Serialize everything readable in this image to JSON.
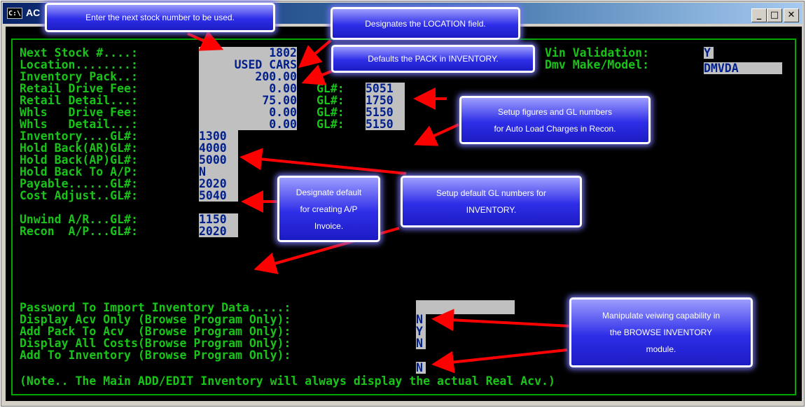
{
  "window": {
    "title": "AC",
    "icon_text": "C:\\",
    "minimize_label": "_",
    "maximize_label": "□",
    "close_label": "✕"
  },
  "colors": {
    "terminal_bg": "#000000",
    "terminal_text": "#19c419",
    "field_bg": "#c0c0c0",
    "field_text": "#001f8a",
    "callout_bg": "#2e2ee8",
    "arrow": "#ff0000"
  },
  "form": {
    "labels": {
      "next_stock": "Next Stock #....:",
      "location": "Location........:",
      "inventory_pack": "Inventory Pack..:",
      "retail_drive_fee": "Retail Drive Fee:",
      "retail_detail": "Retail Detail...:",
      "whls_drive_fee": "Whls   Drive Fee:",
      "whls_detail": "Whls   Detail...:",
      "inventory_gl": "Inventory....GL#:",
      "hold_back_ar_gl": "Hold Back(AR)GL#:",
      "hold_back_ap_gl": "Hold Back(AP)GL#:",
      "hold_back_to_ap": "Hold Back To A/P:",
      "payable_gl": "Payable......GL#:",
      "cost_adjust_gl": "Cost Adjust..GL#:",
      "unwind_ar_gl": "Unwind A/R...GL#:",
      "recon_ap_gl": "Recon  A/P...GL#:",
      "vin_validation": "Vin Validation:",
      "dmv_make_model": "Dmv Make/Model:",
      "gl_prefix": "GL#:",
      "password_import": "Password To Import Inventory Data.....:",
      "display_acv_only": "Display Acv Only (Browse Program Only):",
      "add_pack_to_acv": "Add Pack To Acv  (Browse Program Only):",
      "display_all_costs": "Display All Costs(Browse Program Only):",
      "add_to_inventory": "Add To Inventory (Browse Program Only):",
      "note": "(Note.. The Main ADD/EDIT Inventory will always display the actual Real Acv.)"
    },
    "values": {
      "next_stock": "1802",
      "location": "USED CARS",
      "inventory_pack": "200.00",
      "retail_drive_fee": "0.00",
      "retail_drive_fee_gl": "5051",
      "retail_detail": "75.00",
      "retail_detail_gl": "1750",
      "whls_drive_fee": "0.00",
      "whls_drive_fee_gl": "5150",
      "whls_detail": "0.00",
      "whls_detail_gl": "5150",
      "inventory_gl": "1300",
      "hold_back_ar_gl": "4000",
      "hold_back_ap_gl": "5000",
      "hold_back_to_ap": "N",
      "payable_gl": "2020",
      "cost_adjust_gl": "5040",
      "unwind_ar_gl": "1150",
      "recon_ap_gl": "2020",
      "vin_validation": "Y",
      "dmv_make_model": "DMVDA",
      "password_import": "",
      "display_acv_only": "N",
      "add_pack_to_acv": "Y",
      "display_all_costs": "N",
      "add_to_inventory": "N"
    }
  },
  "callouts": {
    "stock_number": "Enter the next stock number to be used.",
    "location_field": "Designates the LOCATION field.",
    "pack": "Defaults the PACK in INVENTORY.",
    "auto_load": [
      "Setup figures and GL numbers",
      "for Auto Load Charges in Recon."
    ],
    "ap_invoice": [
      "Designate default",
      "for creating A/P",
      "Invoice."
    ],
    "default_gl": [
      "Setup default GL numbers for",
      "INVENTORY."
    ],
    "browse": [
      "Manipulate veiwing capability in",
      "the BROWSE INVENTORY",
      "module."
    ]
  }
}
